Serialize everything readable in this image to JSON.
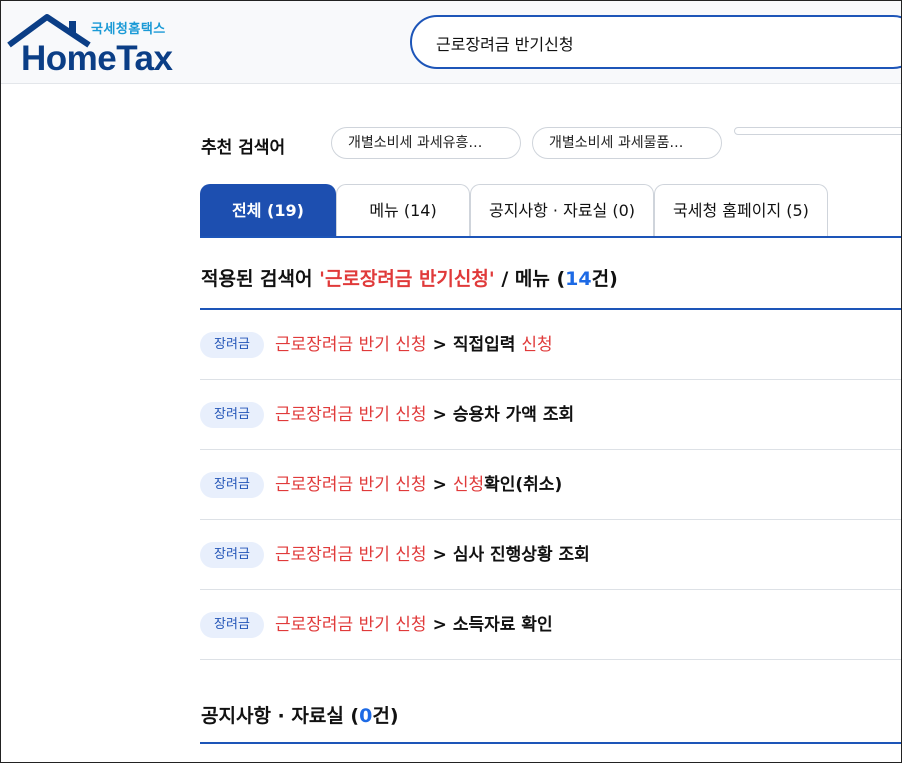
{
  "header": {
    "logo_sub": "국세청홈택스",
    "logo_main": "HomeTax",
    "search_value": "근로장려금 반기신청"
  },
  "recommend": {
    "label": "추천 검색어",
    "chips": [
      "개별소비세 과세유흥…",
      "개별소비세 과세물품…"
    ]
  },
  "tabs": [
    "전체 (19)",
    "메뉴 (14)",
    "공지사항 · 자료실 (0)",
    "국세청 홈페이지 (5)"
  ],
  "result_header": {
    "prefix": "적용된 검색어 ",
    "query": "'근로장려금 반기신청'",
    "middle": " / 메뉴 (",
    "count": "14",
    "suffix": "건)"
  },
  "results": [
    {
      "badge": "장려금",
      "path": "근로장려금 반기 신청",
      "sep": ">",
      "tail_plain": "직접입력 ",
      "tail_red": "신청",
      "tail_after": ""
    },
    {
      "badge": "장려금",
      "path": "근로장려금 반기 신청",
      "sep": ">",
      "tail_plain": "승용차 가액 조회",
      "tail_red": "",
      "tail_after": ""
    },
    {
      "badge": "장려금",
      "path": "근로장려금 반기 신청",
      "sep": ">",
      "tail_plain": "",
      "tail_red": "신청",
      "tail_after": "확인(취소)"
    },
    {
      "badge": "장려금",
      "path": "근로장려금 반기 신청",
      "sep": ">",
      "tail_plain": "심사 진행상황 조회",
      "tail_red": "",
      "tail_after": ""
    },
    {
      "badge": "장려금",
      "path": "근로장려금 반기 신청",
      "sep": ">",
      "tail_plain": "소득자료 확인",
      "tail_red": "",
      "tail_after": ""
    }
  ],
  "notice_header": {
    "prefix": "공지사항 · 자료실 (",
    "count": "0",
    "suffix": "건)"
  },
  "colors": {
    "brand_blue": "#1d4fb0",
    "highlight_red": "#e03a3a",
    "count_blue": "#1d6ae5"
  }
}
